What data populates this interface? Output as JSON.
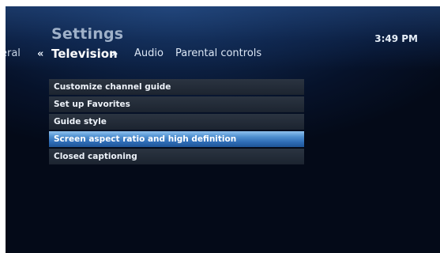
{
  "header": {
    "title": "Settings",
    "time": "3:49 PM"
  },
  "tabs": {
    "prev": "eral",
    "current": "Television",
    "next": [
      "Audio",
      "Parental controls"
    ]
  },
  "menu": {
    "selected_index": 3,
    "items": [
      "Customize channel guide",
      "Set up Favorites",
      "Guide style",
      "Screen aspect ratio and high definition",
      "Closed captioning"
    ]
  },
  "colors": {
    "selection_blue": "#2d6bb5",
    "background": "#06122a"
  }
}
